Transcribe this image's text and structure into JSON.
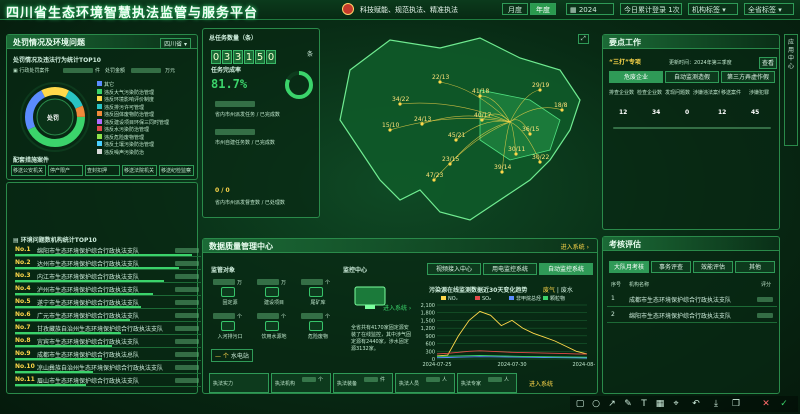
{
  "header": {
    "title": "四川省生态环境智慧执法监管与服务平台",
    "slogan": "科技赋能、规范执法、精准执法",
    "period_month": "月度",
    "period_year": "年度",
    "year_value": "2024",
    "login_count": "今日累计登录 1次",
    "org_select": "机构标签",
    "province_select": "全省标签"
  },
  "left_top": {
    "title": "处罚情况及环境问题",
    "dropdown": "四川省",
    "sub_title": "处罚情况及违法行为统计TOP10",
    "row1_label": "行政处罚案件",
    "row1_unit": "件",
    "row1_label2": "处罚金额",
    "row1_unit2": "万元",
    "donut_center": "处罚",
    "legend": [
      "其它",
      "违反大气污染防治管理",
      "违反环境影响评价制度",
      "违反排污许可管理",
      "违反固体废物防治管理",
      "违反建设项目环保三同时管理",
      "违反水污染防治管理",
      "违反危险废物管理",
      "违反土壤污染防治管理",
      "违反噪声污染防治"
    ],
    "legend_colors": [
      "#5b8cff",
      "#3bd36b",
      "#ffd84a",
      "#29c4c4",
      "#f08a3b",
      "#b06bff",
      "#e24a4a",
      "#8fe34a",
      "#4ad0ff",
      "#d9d9d9"
    ],
    "rectify_title": "配套措施案件",
    "rectify_items": [
      "移送公安机关",
      "停产限产",
      "查封扣押",
      "移送法院机关",
      "移送纪检监察"
    ],
    "rectify_units": [
      "件",
      "件",
      "件",
      "件",
      "件"
    ]
  },
  "left_rank": {
    "title": "环境问题数机构统计TOP10",
    "rows": [
      {
        "no": "No.1",
        "name": "绵阳市生态环境保护综合行政执法支队"
      },
      {
        "no": "No.2",
        "name": "达州市生态环境保护综合行政执法支队"
      },
      {
        "no": "No.3",
        "name": "内江市生态环境保护综合行政执法支队"
      },
      {
        "no": "No.4",
        "name": "泸州市生态环境保护综合行政执法支队"
      },
      {
        "no": "No.5",
        "name": "遂宁市生态环境保护综合行政执法支队"
      },
      {
        "no": "No.6",
        "name": "广元市生态环境保护综合行政执法支队"
      },
      {
        "no": "No.7",
        "name": "甘孜藏族自治州生态环境保护综合行政执法支队"
      },
      {
        "no": "No.8",
        "name": "宜宾市生态环境保护综合行政执法支队"
      },
      {
        "no": "No.9",
        "name": "成都市生态环境保护综合行政执法总队"
      },
      {
        "no": "No.10",
        "name": "凉山彝族自治州生态环境保护综合行政执法支队"
      },
      {
        "no": "No.11",
        "name": "眉山市生态环境保护综合行政执法支队"
      }
    ],
    "bar_fill": [
      0.95,
      0.88,
      0.8,
      0.74,
      0.68,
      0.62,
      0.57,
      0.52,
      0.47,
      0.42,
      0.38
    ]
  },
  "task": {
    "title": "总任务数量（条）",
    "digits": [
      "0",
      "3",
      "3",
      "1",
      "5",
      "0"
    ],
    "unit": "条",
    "rate_title": "任务完成率",
    "rate_value": "81.7%",
    "card1": "省内市州派发任务 / 已完成数",
    "card2": "市州自建任务数 / 已完成数",
    "card3_value": "0 / 0",
    "card3_label": "省内市州派发督查数 / 已处理数"
  },
  "map": {
    "labels": [
      "22/13",
      "34/22",
      "24/13",
      "41/18",
      "29/19",
      "36/15",
      "18/8",
      "45/21",
      "23/15",
      "30/11",
      "40/17",
      "39/14",
      "15/10",
      "47/23",
      "30/22"
    ],
    "expand_icon": "expand-icon"
  },
  "right_top": {
    "title": "要点工作",
    "card_title": "“三打”专项",
    "card_sub": "更新时间：2024年第三季度",
    "btn1": "查看",
    "tabs": [
      "危废企业",
      "自动监测造假",
      "第三方弄虚作假"
    ],
    "cols": [
      "排查企业数",
      "检查企业数",
      "发现问题数",
      "涉嫌违法案件",
      "移送案件",
      "涉嫌犯罪"
    ],
    "values": [
      "12",
      "34",
      "0",
      "12",
      "45"
    ]
  },
  "right_eval": {
    "title": "考核评估",
    "tabs": [
      "大队月考核",
      "事务评查",
      "效能评估",
      "其他"
    ],
    "col_no": "序号",
    "col_name": "机构名称",
    "col_score": "评分",
    "rows": [
      {
        "no": "1",
        "name": "成都市生态环境保护综合行政执法支队"
      },
      {
        "no": "2",
        "name": "绵阳市生态环境保护综合行政执法支队"
      }
    ]
  },
  "data_center": {
    "title": "数据质量管理中心",
    "enter_link": "进入系统",
    "monitor_title": "监管对象",
    "objects": [
      "固定源",
      "建设项目",
      "尾矿库",
      "入河排污口",
      "饮用水源地",
      "危险废物"
    ],
    "obj_counts": [
      "万",
      "万",
      "个",
      "个",
      "个",
      "个"
    ],
    "sensor": "水电站",
    "monitor_center": "监控中心",
    "mc_tabs": [
      "视频接入中心",
      "用电监控系统",
      "自动监控系统"
    ],
    "enter_link2": "进入系统",
    "trend_title": "污染源在线监测数据近30天变化趋势",
    "trend_metric": "废气",
    "trend_metric2": "废水",
    "series_names": [
      "NOₓ",
      "SO₂",
      "非甲烷总烃",
      "颗粒物"
    ],
    "info": "全省共有4170家固定源安装了在线监控，其中涉气固定源有2440家，涉水固定源3132家。",
    "bottom_labels": [
      "执法实力",
      "执法机构",
      "执法装备",
      "执法人员",
      "执法专家"
    ],
    "bottom_values": [
      "个",
      "件",
      "人",
      "人"
    ],
    "bottom_enter": "进入系统"
  },
  "chart_data": {
    "type": "line",
    "x": [
      "2024-07-25",
      "2024-07-30",
      "2024-08-04"
    ],
    "ylim": [
      0,
      2100
    ],
    "yticks": [
      "0",
      "300",
      "600",
      "900",
      "1,200",
      "1,500",
      "1,800",
      "2,100"
    ],
    "series": [
      {
        "name": "NOₓ",
        "color": "#ffd84a",
        "values": [
          120,
          150,
          900,
          1500,
          1850,
          1700,
          1300,
          1500,
          1200,
          1000,
          850,
          700,
          500,
          300,
          200
        ]
      },
      {
        "name": "SO₂",
        "color": "#e24a4a",
        "values": [
          200,
          220,
          260,
          300,
          320,
          300,
          280,
          260,
          250,
          240,
          230,
          220,
          210,
          200,
          190
        ]
      },
      {
        "name": "非甲烷总烃",
        "color": "#5b8cff",
        "values": [
          50,
          60,
          70,
          80,
          90,
          85,
          80,
          75,
          70,
          65,
          60,
          55,
          50,
          45,
          40
        ]
      },
      {
        "name": "颗粒物",
        "color": "#3bd36b",
        "values": [
          100,
          110,
          120,
          130,
          140,
          130,
          120,
          110,
          100,
          95,
          90,
          85,
          80,
          75,
          70
        ]
      }
    ]
  },
  "sidebar": {
    "label": "应用中心"
  }
}
